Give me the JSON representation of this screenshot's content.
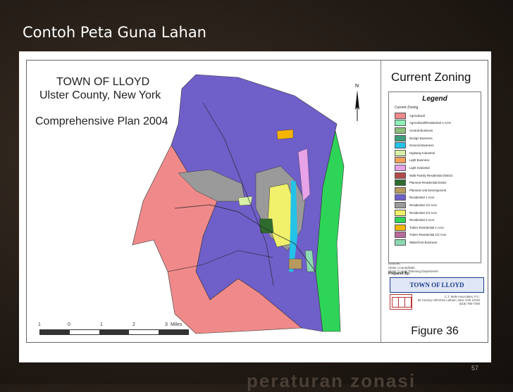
{
  "slide": {
    "title": "Contoh Peta Guna Lahan",
    "page_number": "57",
    "watermark": "peraturan zonasi"
  },
  "map": {
    "title_main": "TOWN OF LLOYD",
    "title_sub": "Ulster County, New York",
    "plan": "Comprehensive Plan 2004",
    "north_label": "N",
    "scale_ticks": [
      "1",
      "0",
      "1",
      "2",
      "3",
      "Miles"
    ]
  },
  "sidebar": {
    "heading": "Current Zoning",
    "legend_title": "Legend",
    "legend_subtitle": "Current Zoning",
    "legend_items": [
      {
        "label": "Agricultural",
        "color": "#f08a8a"
      },
      {
        "label": "Agricultural/Residential 1-Acre",
        "color": "#8ef0b8"
      },
      {
        "label": "Central Business",
        "color": "#8bbf7a"
      },
      {
        "label": "Design Business",
        "color": "#3f9e7a"
      },
      {
        "label": "General Business",
        "color": "#23c2e8"
      },
      {
        "label": "Highway Industrial",
        "color": "#d7f0a6"
      },
      {
        "label": "Light Business",
        "color": "#f2a25a"
      },
      {
        "label": "Light Industrial",
        "color": "#e7a2e8"
      },
      {
        "label": "Multi-Family Residential District",
        "color": "#b34a4a"
      },
      {
        "label": "Planned Residential Distict",
        "color": "#2e6b2e"
      },
      {
        "label": "Planned Unit Development",
        "color": "#b89a60"
      },
      {
        "label": "Residential 1 Acre",
        "color": "#6f5fc9"
      },
      {
        "label": "Residential 1/2 Acre",
        "color": "#9a9a9a"
      },
      {
        "label": "Residential 1/4 Acre",
        "color": "#f0f06a"
      },
      {
        "label": "Residential 2 Acre",
        "color": "#2ed457"
      },
      {
        "label": "Trailer Residential 1 Acre",
        "color": "#f4b400"
      },
      {
        "label": "Trailer Residential 1/2 Acre",
        "color": "#b86a9a"
      },
      {
        "label": "Waterfront Business",
        "color": "#8cd9b0"
      }
    ],
    "sources": "Sources:\nUlster County/EMC\nUlster County Planning Department",
    "prepared_by": "Prepared By:",
    "logo_text": "TOWN OF LLOYD",
    "consultant": "C.T. Male Associates, P.C.\n50 Century Hill Drive Latham, New York 12110\n(518) 786-7400",
    "figure": "Figure 36"
  }
}
